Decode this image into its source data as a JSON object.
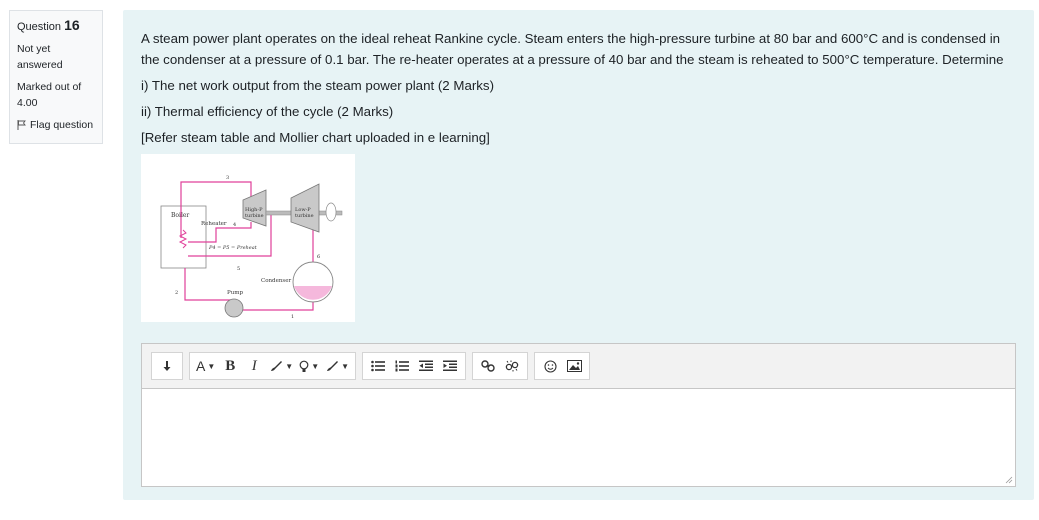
{
  "info": {
    "question_label": "Question",
    "question_number": "16",
    "state": "Not yet answered",
    "grade": "Marked out of 4.00",
    "flag_label": "Flag question"
  },
  "question": {
    "para1": "A steam power plant operates on the ideal reheat Rankine cycle. Steam enters the high-pressure turbine at 80 bar and 600°C and is condensed in the condenser at a pressure of 0.1 bar. The re-heater operates at a pressure of 40 bar and the steam is reheated to 500°C temperature. Determine",
    "para2": "i) The net work output from the steam power plant (2 Marks)",
    "para3": "ii) Thermal efficiency of the cycle (2 Marks)",
    "para4": "[Refer steam table and Mollier chart uploaded in e learning]"
  },
  "diagram": {
    "boiler": "Boiler",
    "reheater": "Reheater",
    "hp_turbine_1": "High-P",
    "hp_turbine_2": "turbine",
    "lp_turbine_1": "Low-P",
    "lp_turbine_2": "turbine",
    "condenser": "Condenser",
    "pump": "Pump",
    "pressure_relation": "P4 = P5 = Preheat",
    "state_1": "1",
    "state_2": "2",
    "state_3": "3",
    "state_4": "4",
    "state_5": "5",
    "state_6": "6"
  },
  "toolbar": {
    "font_label": "A",
    "bold_label": "B",
    "italic_label": "I"
  },
  "colors": {
    "pink_pipe": "#e0409a",
    "content_bg": "#e7f3f5"
  }
}
